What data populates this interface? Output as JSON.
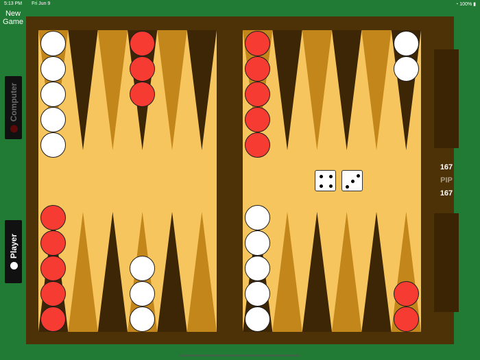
{
  "status_bar": {
    "time": "5:13 PM",
    "date": "Fri Jun 9",
    "battery": "100%"
  },
  "new_game_label": "New\nGame",
  "computer_label": "Computer",
  "player_label": "Player",
  "pip": {
    "top": "167",
    "label": "PIP",
    "bottom": "167"
  },
  "dice": [
    4,
    3
  ],
  "colors": {
    "board_frame": "#4d3208",
    "board_field": "#f7c55e",
    "point_dark": "#3c2606",
    "point_mid": "#c3861b",
    "checker_white": "#ffffff",
    "checker_red": "#f63b32",
    "table": "#217b35"
  },
  "checkers": [
    {
      "point": 13,
      "color": "white",
      "count": 5
    },
    {
      "point": 16,
      "color": "red",
      "count": 3
    },
    {
      "point": 19,
      "color": "red",
      "count": 5
    },
    {
      "point": 24,
      "color": "white",
      "count": 2
    },
    {
      "point": 12,
      "color": "red",
      "count": 5
    },
    {
      "point": 9,
      "color": "white",
      "count": 3
    },
    {
      "point": 6,
      "color": "white",
      "count": 5
    },
    {
      "point": 1,
      "color": "red",
      "count": 2
    }
  ]
}
